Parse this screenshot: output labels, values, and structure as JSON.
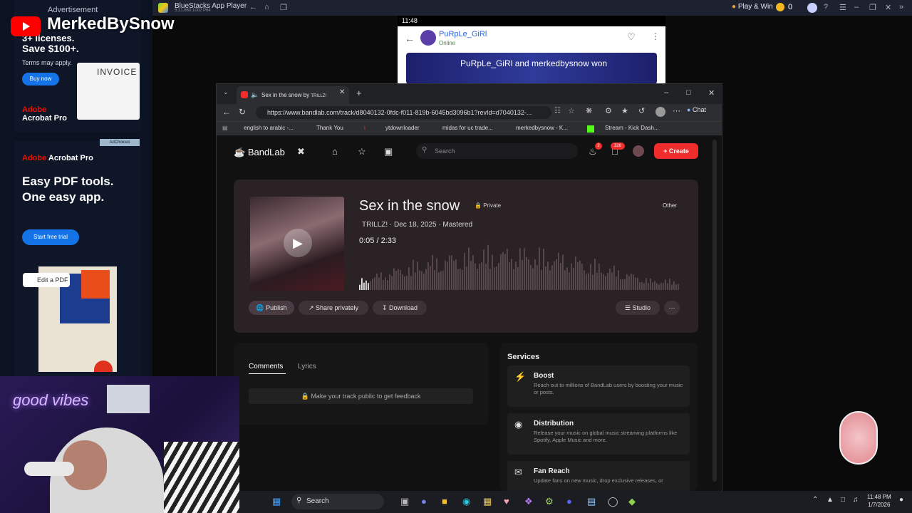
{
  "streamer": {
    "channel_name": "MerkedBySnow"
  },
  "ads": {
    "label": "Advertisement",
    "top": {
      "headline": "Save $100+.",
      "partial_headline": "3+ licenses.",
      "terms": "Terms may apply.",
      "button": "Buy now",
      "image_text": "INVOICE",
      "brand_red": "Adobe",
      "brand_product": "Acrobat Pro"
    },
    "middle": {
      "adchoices": "AdChoices",
      "brand_red": "Adobe",
      "brand_product": "Acrobat Pro",
      "headline": "Easy PDF tools. One easy app.",
      "button": "Start free trial",
      "edit_chip": "Edit a PDF"
    }
  },
  "bluestacks": {
    "title": "BlueStacks App Player",
    "version": "5.21.660.1002 P64",
    "play_win": "Play & Win",
    "coins": "0"
  },
  "phone": {
    "time": "11:48",
    "contact_name": "PuRpLe_GiRl",
    "contact_status": "Online",
    "game_message": "PuRpLe_GiRl and merkedbysnow won"
  },
  "browser": {
    "tab_title": "Sex in the snow by",
    "tab_artist_emoji": "TRILLZ!",
    "url": "https://www.bandlab.com/track/d8040132-0fdc-f011-819b-6045bd3096b1?revId=d7040132-...",
    "chat_label": "Chat",
    "bookmarks": [
      "english to arabic -...",
      "Thank You",
      "i",
      "ytdownloader",
      "midas for uc trade...",
      "merkedbysnow - K...",
      "",
      "Stream - Kick Dash..."
    ]
  },
  "bandlab": {
    "logo": "BandLab",
    "search_placeholder": "Search",
    "notification_count": "2",
    "message_count": "328",
    "create_label": "Create",
    "track": {
      "title": "Sex in the snow",
      "visibility": "Private",
      "genre": "Other",
      "artist": "TRILLZ!",
      "date": "Dec 18, 2025",
      "status": "Mastered",
      "current_time": "0:05",
      "duration": "2:33",
      "progress": 0.033
    },
    "actions": {
      "publish": "Publish",
      "share": "Share privately",
      "download": "Download",
      "studio": "Studio",
      "more": "···"
    },
    "comments": {
      "tab_comments": "Comments",
      "tab_lyrics": "Lyrics",
      "feedback_notice": "Make your track public to get feedback"
    },
    "services": {
      "title": "Services",
      "items": [
        {
          "name": "Boost",
          "desc": "Reach out to millions of BandLab users by boosting your music or posts.",
          "icon": "bolt-icon"
        },
        {
          "name": "Distribution",
          "desc": "Release your music on global music streaming platforms like Spotify, Apple Music and more.",
          "icon": "distribution-icon"
        },
        {
          "name": "Fan Reach",
          "desc": "Update fans on new music, drop exclusive releases, or",
          "icon": "message-icon"
        }
      ]
    }
  },
  "webcam": {
    "neon_sign": "good vibes"
  },
  "taskbar": {
    "search": "Search",
    "time": "11:48 PM",
    "date": "1/7/2026"
  },
  "colors": {
    "bandlab_red": "#f02c2c",
    "adobe_blue": "#1473e6",
    "card_bg": "#2b2226"
  }
}
